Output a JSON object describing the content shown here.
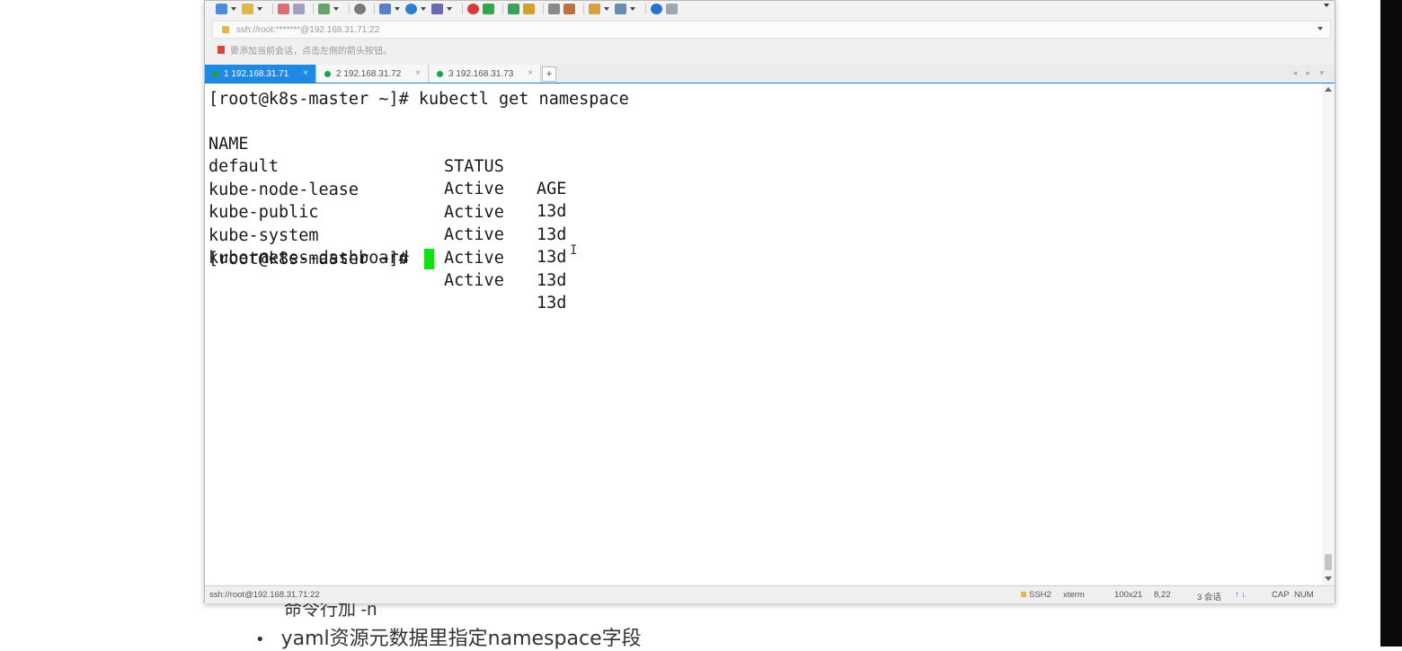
{
  "window": {
    "toolbar_icons": [
      "new-session-icon",
      "open-folder-icon",
      "cut-icon",
      "copy-icon",
      "properties-icon",
      "find-icon",
      "layout-icon",
      "globe-icon",
      "font-icon",
      "stop-red-icon",
      "run-green-icon",
      "fullscreen-icon",
      "lock-icon",
      "keyboard-icon",
      "brush-icon",
      "folder-icon",
      "window-icon",
      "help-icon",
      "chat-icon"
    ],
    "address": "ssh://root:*******@192.168.31.71:22",
    "hint": "要添加当前会话，点击左侧的箭头按钮。"
  },
  "tabs": [
    {
      "label": "1 192.168.31.71",
      "active": true,
      "close": "×"
    },
    {
      "label": "2 192.168.31.72",
      "active": false,
      "close": "×"
    },
    {
      "label": "3 192.168.31.73",
      "active": false,
      "close": "×"
    }
  ],
  "tab_add": "+",
  "tab_nav": "◂ ▸ ▾",
  "terminal": {
    "prompt_cmd": "[root@k8s-master ~]# kubectl get namespace",
    "headers": [
      "NAME",
      "STATUS",
      "AGE"
    ],
    "rows": [
      [
        "default",
        "Active",
        "13d"
      ],
      [
        "kube-node-lease",
        "Active",
        "13d"
      ],
      [
        "kube-public",
        "Active",
        "13d"
      ],
      [
        "kube-system",
        "Active",
        "13d"
      ],
      [
        "kubernetes-dashboard",
        "Active",
        "13d"
      ]
    ],
    "prompt": "[root@k8s-master ~]# ",
    "cursor_color": "#11e011"
  },
  "status": {
    "left": "ssh://root@192.168.31.71:22",
    "protocol": "SSH2",
    "term": "xterm",
    "size": "100x21",
    "pos": "8,22",
    "sessions": "3 会话",
    "caps": "CAP",
    "num": "NUM"
  },
  "slide": {
    "partial": "命令行加 -n",
    "bullet": "•",
    "line": "yaml资源元数据里指定namespace字段"
  }
}
